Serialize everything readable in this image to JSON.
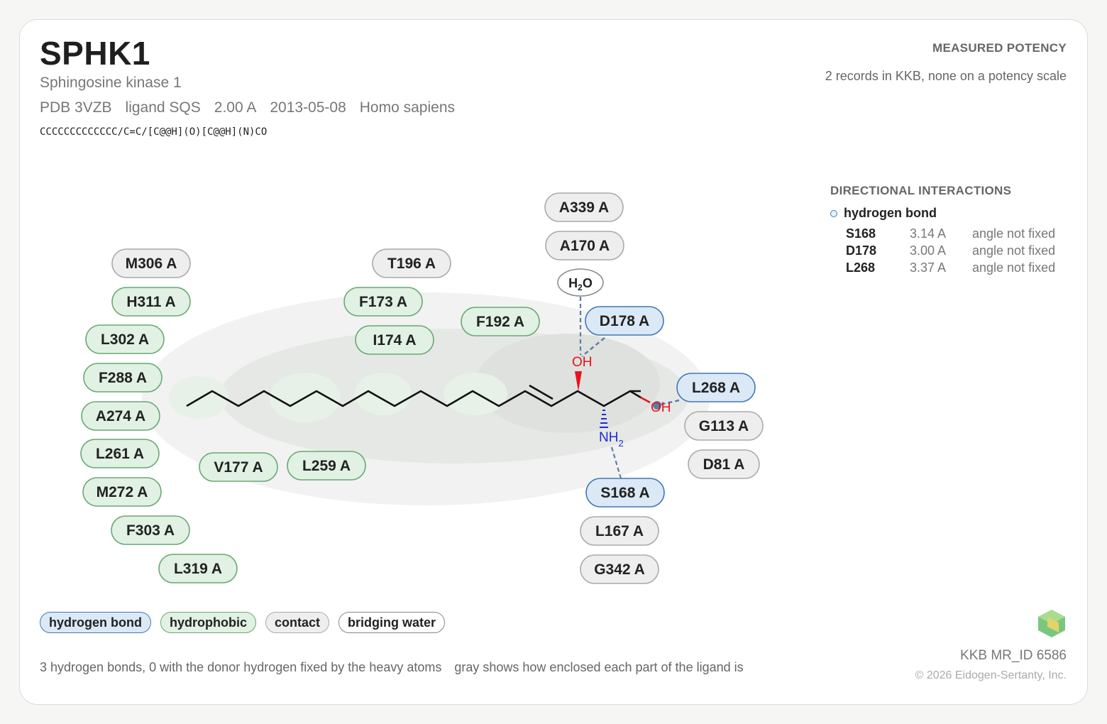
{
  "header": {
    "title": "SPHK1",
    "subtitle": "Sphingosine kinase 1",
    "pdb": "PDB 3VZB",
    "ligand": "ligand SQS",
    "resolution": "2.00 A",
    "date": "2013-05-08",
    "organism": "Homo sapiens",
    "smiles": "CCCCCCCCCCCCC/C=C/[C@@H](O)[C@@H](N)CO"
  },
  "potency": {
    "label": "MEASURED POTENCY",
    "note": "2 records in KKB, none on a potency scale"
  },
  "directional": {
    "title": "DIRECTIONAL INTERACTIONS",
    "type_label": "hydrogen bond",
    "rows": [
      {
        "residue": "S168",
        "distance": "3.14 A",
        "angle": "angle not fixed"
      },
      {
        "residue": "D178",
        "distance": "3.00 A",
        "angle": "angle not fixed"
      },
      {
        "residue": "L268",
        "distance": "3.37 A",
        "angle": "angle not fixed"
      }
    ]
  },
  "residues": [
    {
      "label": "A339 A",
      "type": "contact"
    },
    {
      "label": "A170 A",
      "type": "contact"
    },
    {
      "label": "M306 A",
      "type": "contact"
    },
    {
      "label": "T196 A",
      "type": "contact"
    },
    {
      "label": "H311 A",
      "type": "hydrophobic"
    },
    {
      "label": "F173 A",
      "type": "hydrophobic"
    },
    {
      "label": "F192 A",
      "type": "hydrophobic"
    },
    {
      "label": "D178 A",
      "type": "hbond"
    },
    {
      "label": "L302 A",
      "type": "hydrophobic"
    },
    {
      "label": "I174 A",
      "type": "hydrophobic"
    },
    {
      "label": "F288 A",
      "type": "hydrophobic"
    },
    {
      "label": "L268 A",
      "type": "hbond"
    },
    {
      "label": "A274 A",
      "type": "hydrophobic"
    },
    {
      "label": "G113 A",
      "type": "contact"
    },
    {
      "label": "L261 A",
      "type": "hydrophobic"
    },
    {
      "label": "V177 A",
      "type": "hydrophobic"
    },
    {
      "label": "L259 A",
      "type": "hydrophobic"
    },
    {
      "label": "D81 A",
      "type": "contact"
    },
    {
      "label": "M272 A",
      "type": "hydrophobic"
    },
    {
      "label": "S168 A",
      "type": "hbond"
    },
    {
      "label": "F303 A",
      "type": "hydrophobic"
    },
    {
      "label": "L167 A",
      "type": "contact"
    },
    {
      "label": "L319 A",
      "type": "hydrophobic"
    },
    {
      "label": "G342 A",
      "type": "contact"
    }
  ],
  "ligand_atoms": {
    "oh1": "OH",
    "oh2": "OH",
    "nh2": "NH",
    "nh2_sub": "2",
    "water": "H",
    "water_sub": "2",
    "water_o": "O"
  },
  "legend": {
    "hbond": "hydrogen bond",
    "hydrophobic": "hydrophobic",
    "contact": "contact",
    "water": "bridging water"
  },
  "footer": {
    "note1": "3 hydrogen bonds, 0 with the donor hydrogen fixed by the heavy atoms",
    "note2": "gray shows how enclosed each part of the ligand is",
    "record_id": "KKB MR_ID 6586",
    "copyright": "© 2026 Eidogen-Sertanty, Inc."
  },
  "colors": {
    "hbond_fill": "#dbe8f6",
    "hbond_stroke": "#3f79b5",
    "hydrophobic_fill": "#e1f1e3",
    "hydrophobic_stroke": "#69a873",
    "contact_fill": "#eeeeee",
    "contact_stroke": "#aaaaaa",
    "oxygen": "#e8131a",
    "nitrogen": "#1f2ad8"
  }
}
